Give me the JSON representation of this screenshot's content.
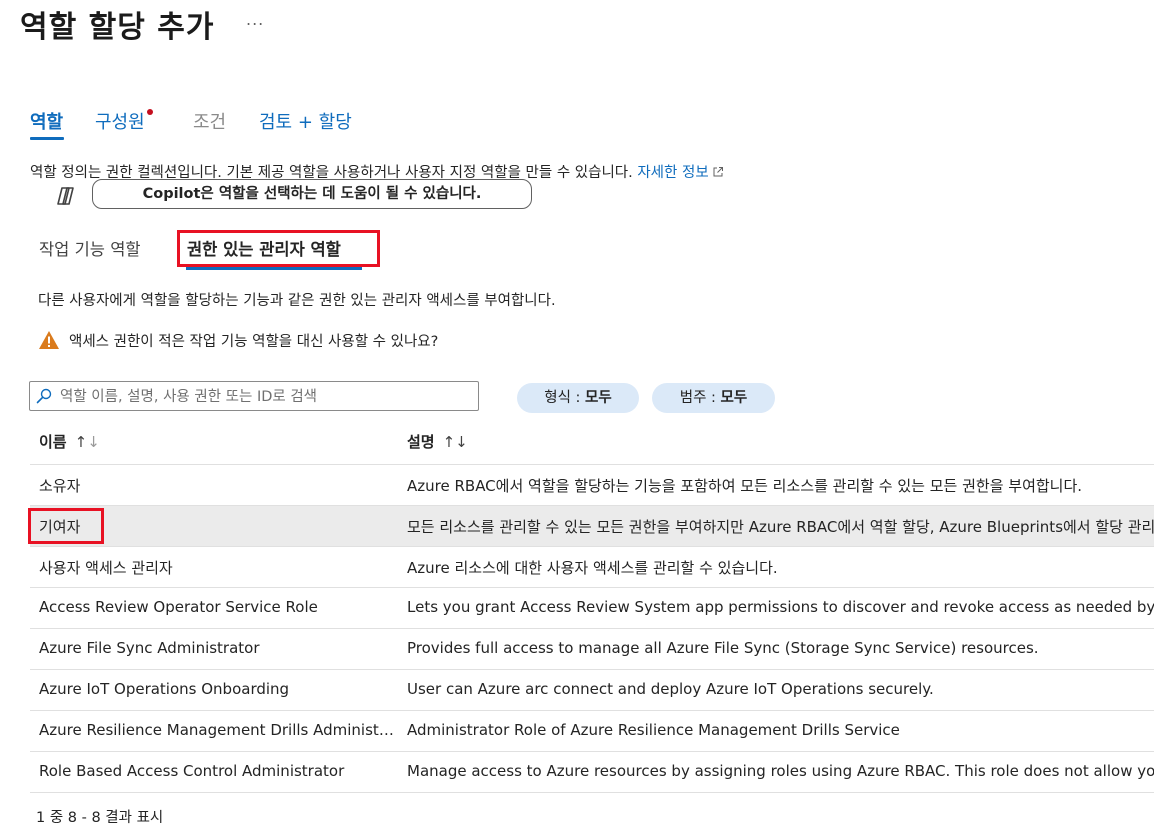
{
  "page": {
    "title": "역할 할당 추가",
    "more_label": "...",
    "tabs": [
      {
        "label": "역할",
        "state": "active"
      },
      {
        "label": "구성원",
        "state": "required"
      },
      {
        "label": "조건",
        "state": "disabled"
      },
      {
        "label": "검토 + 할당",
        "state": "normal"
      }
    ],
    "description": "역할 정의는 권한 컬렉션입니다. 기본 제공 역할을 사용하거나 사용자 지정 역할을 만들 수 있습니다.",
    "learn_more": "자세한 정보",
    "copilot_button": "Copilot은 역할을 선택하는 데 도움이 될 수 있습니다.",
    "subtabs": [
      {
        "label": "작업 기능 역할"
      },
      {
        "label": "권한 있는 관리자 역할"
      }
    ],
    "subtab_description": "다른 사용자에게 역할을 할당하는 기능과 같은 권한 있는 관리자 액세스를 부여합니다.",
    "warning": "액세스 권한이 적은 작업 기능 역할을 대신 사용할 수 있나요?",
    "search_placeholder": "역할 이름, 설명, 사용 권한 또는 ID로 검색",
    "filters": [
      {
        "label": "형식 : ",
        "value": "모두"
      },
      {
        "label": "범주 : ",
        "value": "모두"
      }
    ],
    "columns": {
      "name": "이름",
      "description": "설명"
    },
    "sort_name": "↑",
    "sort_name_dim": "↓",
    "sort_desc": "↑↓",
    "rows": [
      {
        "name": "소유자",
        "description": "Azure RBAC에서 역할을 할당하는 기능을 포함하여 모든 리소스를 관리할 수 있는 모든 권한을 부여합니다."
      },
      {
        "name": "기여자",
        "description": "모든 리소스를 관리할 수 있는 모든 권한을 부여하지만 Azure RBAC에서 역할 할당, Azure Blueprints에서 할당 관리"
      },
      {
        "name": "사용자 액세스 관리자",
        "description": "Azure 리소스에 대한 사용자 액세스를 관리할 수 있습니다."
      },
      {
        "name": "Access Review Operator Service Role",
        "description": "Lets you grant Access Review System app permissions to discover and revoke access as needed by the"
      },
      {
        "name": "Azure File Sync Administrator",
        "description": "Provides full access to manage all Azure File Sync (Storage Sync Service) resources."
      },
      {
        "name": "Azure IoT Operations Onboarding",
        "description": "User can Azure arc connect and deploy Azure IoT Operations securely."
      },
      {
        "name": "Azure Resilience Management Drills Administrator",
        "description": "Administrator Role of Azure Resilience Management Drills Service"
      },
      {
        "name": "Role Based Access Control Administrator",
        "description": "Manage access to Azure resources by assigning roles using Azure RBAC. This role does not allow you"
      }
    ],
    "selected_row": 1,
    "pager": "1 중 8 - 8 결과 표시"
  },
  "colors": {
    "accent": "#0f6cbd",
    "highlight": "#e81123",
    "warning": "#da7b1d",
    "pill": "#dbe9f8"
  }
}
